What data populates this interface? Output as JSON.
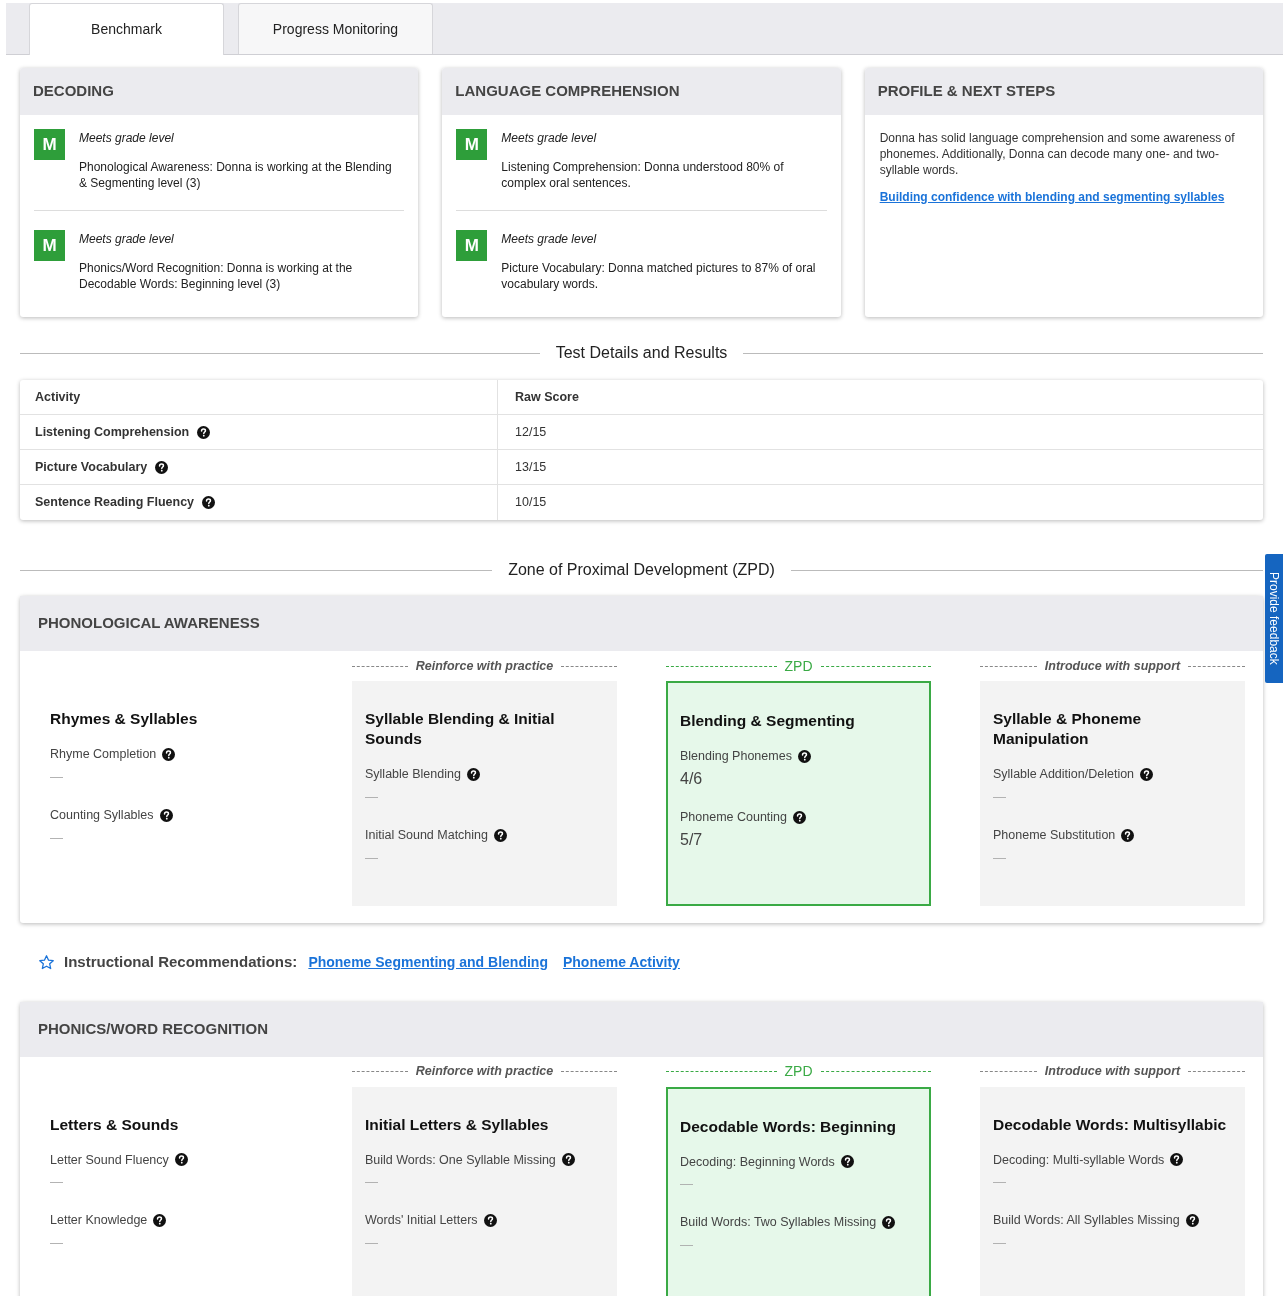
{
  "tabs": [
    {
      "label": "Benchmark",
      "selected": true
    },
    {
      "label": "Progress Monitoring",
      "selected": false
    }
  ],
  "summary_cards": [
    {
      "title": "DECODING",
      "kind": "results",
      "results": [
        {
          "badge": "M",
          "status": "Meets grade level",
          "text": "Phonological Awareness: Donna is working at the Blending & Segmenting level (3)"
        },
        {
          "badge": "M",
          "status": "Meets grade level",
          "text": "Phonics/Word Recognition: Donna is working at the Decodable Words: Beginning level (3)"
        }
      ]
    },
    {
      "title": "LANGUAGE COMPREHENSION",
      "kind": "results",
      "results": [
        {
          "badge": "M",
          "status": "Meets grade level",
          "text": "Listening Comprehension: Donna understood 80% of complex oral sentences."
        },
        {
          "badge": "M",
          "status": "Meets grade level",
          "text": "Picture Vocabulary: Donna matched pictures to 87% of oral vocabulary words."
        }
      ]
    },
    {
      "title": "PROFILE & NEXT STEPS",
      "kind": "text",
      "paragraph": "Donna has solid language comprehension and some awareness of phonemes. Additionally, Donna can decode many one- and two-syllable words.",
      "link": "Building confidence with blending and segmenting syllables"
    }
  ],
  "test_details": {
    "heading": "Test Details and Results",
    "columns": [
      "Activity",
      "Raw Score"
    ],
    "rows": [
      {
        "activity": "Listening Comprehension",
        "score": "12/15"
      },
      {
        "activity": "Picture Vocabulary",
        "score": "13/15"
      },
      {
        "activity": "Sentence Reading Fluency",
        "score": "10/15"
      }
    ]
  },
  "zpd": {
    "heading": "Zone of Proximal Development (ZPD)",
    "domains": [
      {
        "title": "PHONOLOGICAL AWARENESS",
        "levels": [
          {
            "kind": "mastered",
            "title": "Rhymes & Syllables",
            "measures": [
              {
                "name": "Rhyme Completion",
                "score": "—"
              },
              {
                "name": "Counting Syllables",
                "score": "—"
              }
            ]
          },
          {
            "kind": "reinforce",
            "band_label": "Reinforce with practice",
            "title": "Syllable Blending & Initial Sounds",
            "measures": [
              {
                "name": "Syllable Blending",
                "score": "—"
              },
              {
                "name": "Initial Sound Matching",
                "score": "—"
              }
            ]
          },
          {
            "kind": "zpd",
            "band_label": "ZPD",
            "title": "Blending & Segmenting",
            "measures": [
              {
                "name": "Blending Phonemes",
                "score": "4/6"
              },
              {
                "name": "Phoneme Counting",
                "score": "5/7"
              }
            ]
          },
          {
            "kind": "introduce",
            "band_label": "Introduce with support",
            "title": "Syllable & Phoneme Manipulation",
            "measures": [
              {
                "name": "Syllable Addition/Deletion",
                "score": "—"
              },
              {
                "name": "Phoneme Substitution",
                "score": "—"
              }
            ]
          }
        ],
        "recommendations": {
          "label": "Instructional Recommendations:",
          "links": [
            "Phoneme Segmenting and Blending",
            "Phoneme Activity"
          ]
        }
      },
      {
        "title": "PHONICS/WORD RECOGNITION",
        "levels": [
          {
            "kind": "mastered",
            "title": "Letters & Sounds",
            "measures": [
              {
                "name": "Letter Sound Fluency",
                "score": "—"
              },
              {
                "name": "Letter Knowledge",
                "score": "—"
              }
            ]
          },
          {
            "kind": "reinforce",
            "band_label": "Reinforce with practice",
            "title": "Initial Letters & Syllables",
            "measures": [
              {
                "name": "Build Words: One Syllable Missing",
                "score": "—"
              },
              {
                "name": "Words' Initial Letters",
                "score": "—"
              }
            ]
          },
          {
            "kind": "zpd",
            "band_label": "ZPD",
            "title": "Decodable Words: Beginning",
            "measures": [
              {
                "name": "Decoding: Beginning Words",
                "score": "—"
              },
              {
                "name": "Build Words: Two Syllables Missing",
                "score": "—"
              }
            ]
          },
          {
            "kind": "introduce",
            "band_label": "Introduce with support",
            "title": "Decodable Words: Multisyllabic",
            "measures": [
              {
                "name": "Decoding: Multi-syllable Words",
                "score": "—"
              },
              {
                "name": "Build Words: All Syllables Missing",
                "score": "—"
              }
            ]
          }
        ]
      }
    ]
  },
  "feedback_tab": {
    "label": "Provide feedback"
  }
}
